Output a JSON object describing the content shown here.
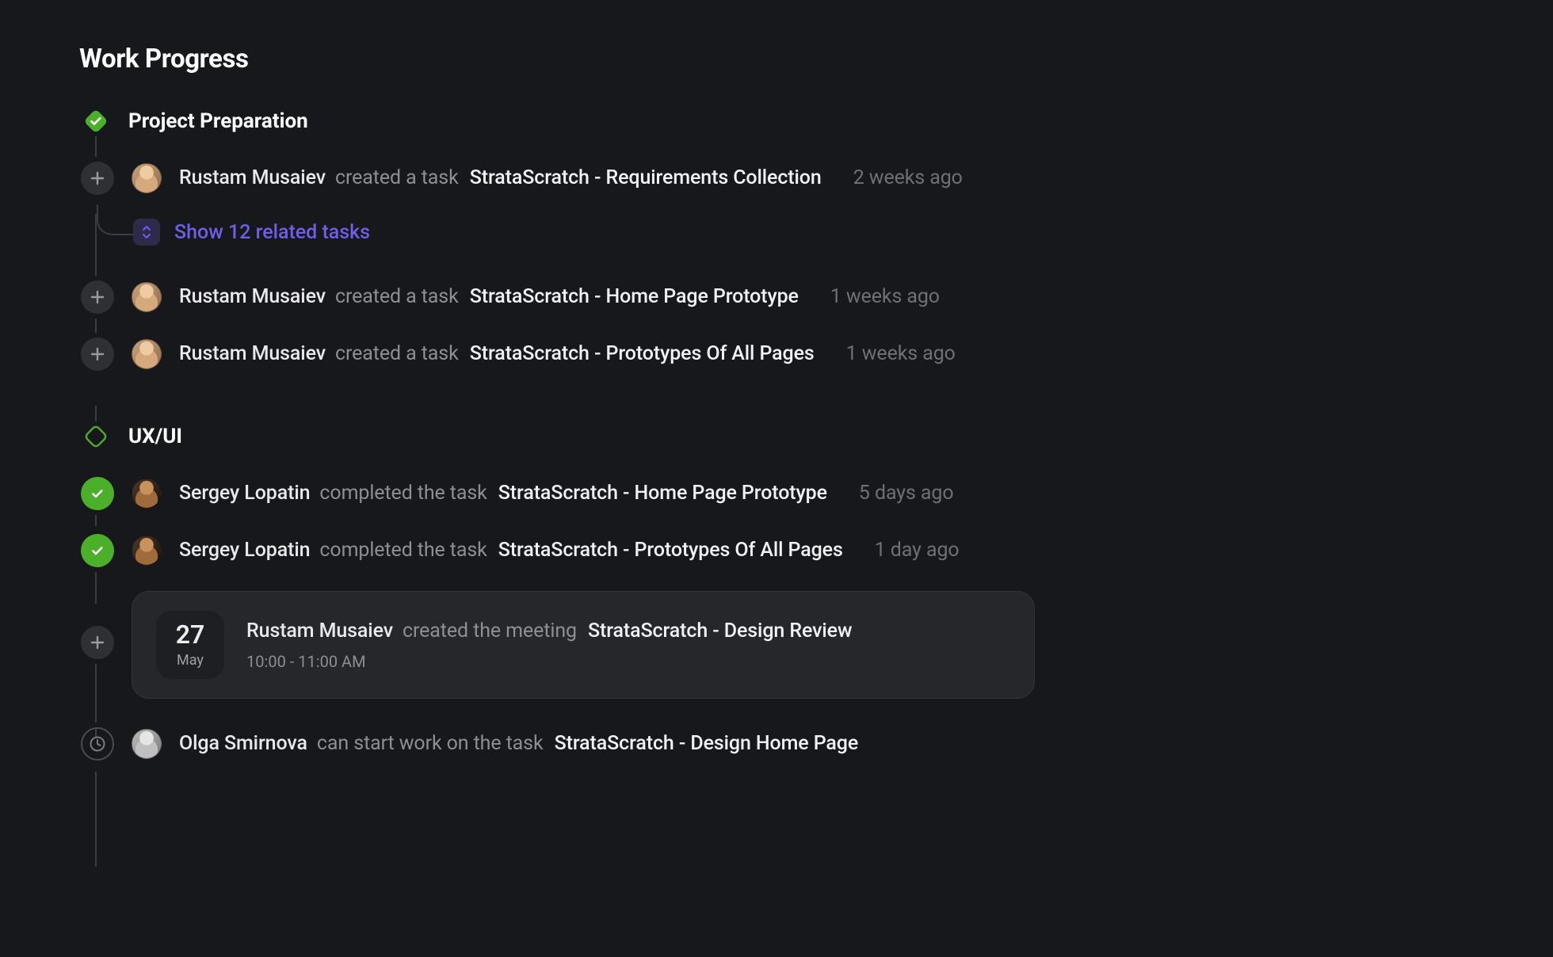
{
  "title": "Work Progress",
  "sections": [
    {
      "id": "project-preparation",
      "label": "Project Preparation",
      "state": "done",
      "items": [
        {
          "type": "task_created",
          "icon": "plus",
          "avatar": "light",
          "who": "Rustam Musaiev",
          "verb": "created a task",
          "obj": "StrataScratch - Requirements Collection",
          "time": "2 weeks ago"
        },
        {
          "type": "related",
          "count_label": "Show 12 related tasks"
        },
        {
          "type": "task_created",
          "icon": "plus",
          "avatar": "light",
          "who": "Rustam Musaiev",
          "verb": "created a task",
          "obj": "StrataScratch - Home Page Prototype",
          "time": "1 weeks ago"
        },
        {
          "type": "task_created",
          "icon": "plus",
          "avatar": "light",
          "who": "Rustam Musaiev",
          "verb": "created a task",
          "obj": "StrataScratch - Prototypes Of All Pages",
          "time": "1 weeks ago"
        }
      ]
    },
    {
      "id": "ux-ui",
      "label": "UX/UI",
      "state": "pending",
      "items": [
        {
          "type": "task_completed",
          "icon": "check",
          "avatar": "dark",
          "who": "Sergey Lopatin",
          "verb": "completed the task",
          "obj": "StrataScratch - Home Page Prototype",
          "time": "5 days ago"
        },
        {
          "type": "task_completed",
          "icon": "check",
          "avatar": "dark",
          "who": "Sergey Lopatin",
          "verb": "completed the task",
          "obj": "StrataScratch - Prototypes Of All Pages",
          "time": "1 day ago"
        },
        {
          "type": "meeting",
          "icon": "plus",
          "date_day": "27",
          "date_month": "May",
          "who": "Rustam Musaiev",
          "verb": "created the meeting",
          "obj": "StrataScratch - Design Review",
          "subtitle": "10:00 - 11:00 AM"
        },
        {
          "type": "can_start",
          "icon": "clock",
          "avatar": "gray",
          "who": "Olga Smirnova",
          "verb": "can start work on the task",
          "obj": "StrataScratch - Design Home Page"
        }
      ]
    }
  ]
}
